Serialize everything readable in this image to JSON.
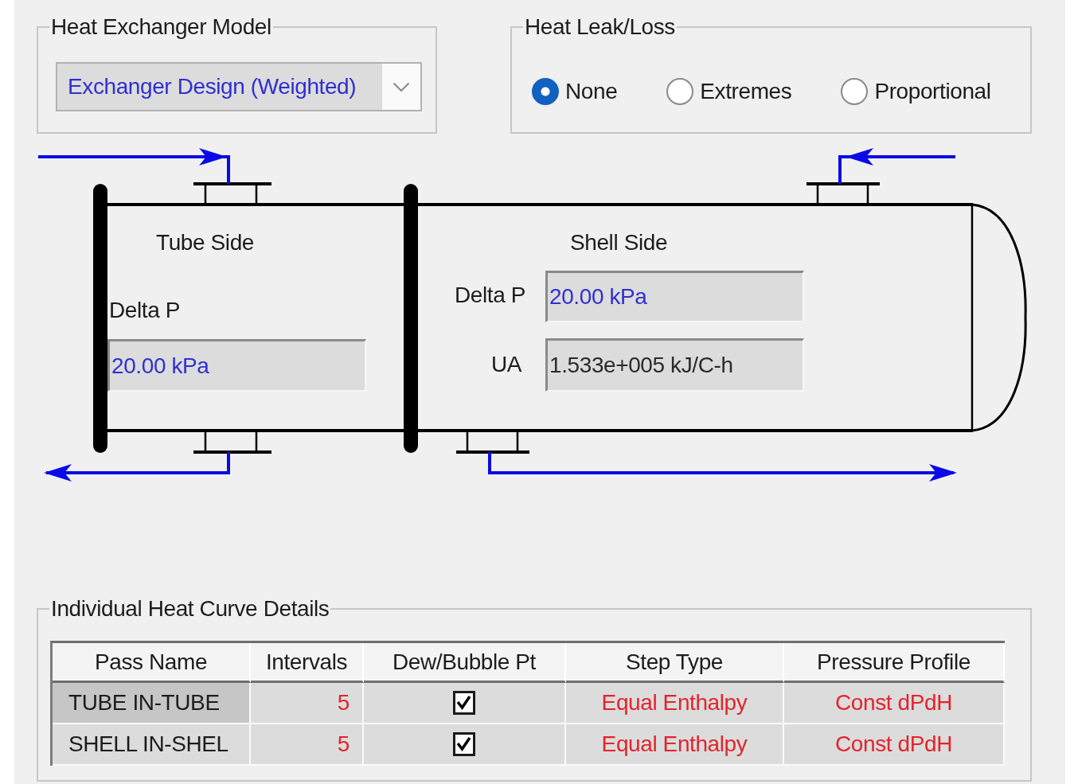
{
  "heat_exchanger_model": {
    "title": "Heat Exchanger Model",
    "value": "Exchanger Design (Weighted)"
  },
  "heat_leak_loss": {
    "title": "Heat Leak/Loss",
    "options": [
      {
        "label": "None",
        "selected": true
      },
      {
        "label": "Extremes",
        "selected": false
      },
      {
        "label": "Proportional",
        "selected": false
      }
    ]
  },
  "diagram": {
    "tube_side": {
      "title": "Tube Side",
      "fields": [
        {
          "label": "Delta P",
          "value": "20.00 kPa",
          "specified": true
        }
      ]
    },
    "shell_side": {
      "title": "Shell Side",
      "fields": [
        {
          "label": "Delta P",
          "value": "20.00 kPa",
          "specified": true
        },
        {
          "label": "UA",
          "value": "1.533e+005 kJ/C-h",
          "specified": false
        }
      ]
    }
  },
  "heat_curve_details": {
    "title": "Individual Heat Curve Details",
    "table": {
      "columns": [
        {
          "label": "Pass Name",
          "kind": "text"
        },
        {
          "label": "Intervals",
          "kind": "number"
        },
        {
          "label": "Dew/Bubble Pt",
          "kind": "checkbox"
        },
        {
          "label": "Step Type",
          "kind": "dropdown"
        },
        {
          "label": "Pressure Profile",
          "kind": "dropdown"
        }
      ],
      "rows": [
        {
          "selected": true,
          "cells": [
            {
              "text": "TUBE IN-TUBE"
            },
            {
              "text": "5"
            },
            {
              "checked": true
            },
            {
              "text": "Equal Enthalpy"
            },
            {
              "text": "Const dPdH"
            }
          ]
        },
        {
          "selected": false,
          "cells": [
            {
              "text": "SHELL IN-SHEL"
            },
            {
              "text": "5"
            },
            {
              "checked": true
            },
            {
              "text": "Equal Enthalpy"
            },
            {
              "text": "Const dPdH"
            }
          ]
        }
      ]
    }
  }
}
